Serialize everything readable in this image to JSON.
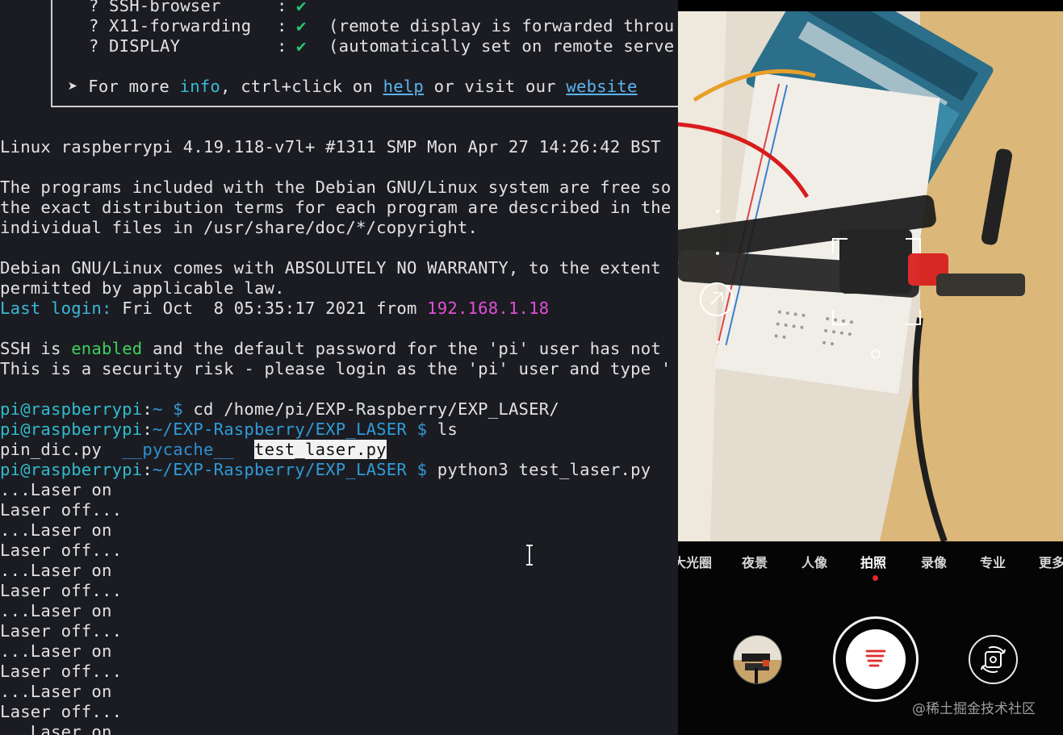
{
  "terminal": {
    "banner": {
      "rows": [
        {
          "mark": "?",
          "key": "SSH-browser",
          "colon": ":",
          "check": "✔",
          "note": ""
        },
        {
          "mark": "?",
          "key": "X11-forwarding",
          "colon": ":",
          "check": "✔",
          "note": "(remote display is forwarded throu"
        },
        {
          "mark": "?",
          "key": "DISPLAY",
          "colon": ":",
          "check": "✔",
          "note": "(automatically set on remote serve"
        }
      ],
      "more": {
        "arrow": "➤",
        "prefix": "For more ",
        "info": "info",
        "mid": ", ctrl+click on ",
        "help": "help",
        "or": " or visit our ",
        "website": "website"
      }
    },
    "motd": {
      "uname": "Linux raspberrypi 4.19.118-v7l+ #1311 SMP Mon Apr 27 14:26:42 BST",
      "p1": "The programs included with the Debian GNU/Linux system are free so",
      "p2": "the exact distribution terms for each program are described in the",
      "p3": "individual files in /usr/share/doc/*/copyright.",
      "w1": "Debian GNU/Linux comes with ABSOLUTELY NO WARRANTY, to the extent",
      "w2": "permitted by applicable law.",
      "last_label": "Last login:",
      "last_text": " Fri Oct  8 05:35:17 2021 from ",
      "last_ip": "192.168.1.18",
      "ssh1_a": "SSH is ",
      "ssh1_b": "enabled",
      "ssh1_c": " and the default password for the 'pi' user has not",
      "ssh2": "This is a security risk - please login as the 'pi' user and type '"
    },
    "session": {
      "user_host": "pi@raspberrypi",
      "colon": ":",
      "cmd1_path": "~",
      "prompt_sym": " $ ",
      "cmd1": "cd /home/pi/EXP-Raspberry/EXP_LASER/",
      "cmd2_path": "~/EXP-Raspberry/EXP_LASER",
      "cmd2": "ls",
      "ls_file1": "pin_dic.py",
      "ls_dir": "__pycache__",
      "ls_file2": "test_laser.py",
      "cmd3_path": "~/EXP-Raspberry/EXP_LASER",
      "cmd3": "python3 test_laser.py",
      "output": [
        "...Laser on",
        "Laser off...",
        "...Laser on",
        "Laser off...",
        "...Laser on",
        "Laser off...",
        "...Laser on",
        "Laser off...",
        "...Laser on",
        "Laser off...",
        "...Laser on",
        "Laser off...",
        "...Laser on"
      ]
    }
  },
  "camera": {
    "modes": [
      "大光圈",
      "夜景",
      "人像",
      "拍照",
      "录像",
      "专业",
      "更多"
    ],
    "active_mode": "拍照",
    "watermark": "@稀土掘金技术社区",
    "icons": {
      "gallery": "gallery-thumbnail",
      "shutter": "shutter-icon",
      "flip": "flip-camera-icon",
      "focus": "focus-bracket-icon",
      "aperture": "aperture-icon"
    }
  },
  "colors": {
    "terminal_bg": "#1b1c22",
    "prompt_user": "#2fbccf",
    "prompt_path": "#2f9bd8",
    "ip_magenta": "#e24ed4",
    "enabled_green": "#3fcf5c",
    "shutter_accent": "#e02a2a"
  }
}
